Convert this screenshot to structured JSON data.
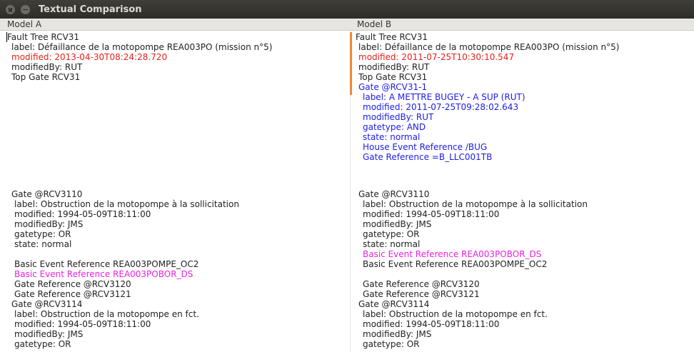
{
  "window": {
    "title": "Textual Comparison"
  },
  "colors": {
    "modified_removed": "#e8221a",
    "added": "#1c1ce6",
    "moved": "#f020e6",
    "change_marker": "#f08a34"
  },
  "paneA": {
    "header": "Model A",
    "lines": [
      "Fault Tree RCV31",
      "label: Défaillance de la motopompe REA003PO (mission n°5)",
      "modified: 2013-04-30T08:24:28.720",
      "modifiedBy: RUT",
      "Top Gate RCV31",
      "Gate @RCV3110",
      "label: Obstruction de la motopompe à la sollicitation",
      "modified: 1994-05-09T18:11:00",
      "modifiedBy: JMS",
      "gatetype: OR",
      "state: normal",
      "Basic Event Reference REA003POMPE_OC2",
      "Basic Event Reference REA003POBOR_DS",
      "Gate Reference @RCV3120",
      "Gate Reference @RCV3121",
      "Gate @RCV3114",
      "label: Obstruction de la motopompe en fct.",
      "modified: 1994-05-09T18:11:00",
      "modifiedBy: JMS",
      "gatetype: OR"
    ]
  },
  "paneB": {
    "header": "Model B",
    "lines": [
      "Fault Tree RCV31",
      "label: Défaillance de la motopompe REA003PO (mission n°5)",
      "modified: 2011-07-25T10:30:10.547",
      "modifiedBy: RUT",
      "Top Gate RCV31",
      "Gate @RCV31-1",
      "label: A METTRE BUGEY - A SUP (RUT)",
      "modified: 2011-07-25T09:28:02.643",
      "modifiedBy: RUT",
      "gatetype: AND",
      "state: normal",
      "House Event Reference /BUG",
      "Gate Reference =B_LLC001TB",
      "Gate @RCV3110",
      "label: Obstruction de la motopompe à la sollicitation",
      "modified: 1994-05-09T18:11:00",
      "modifiedBy: JMS",
      "gatetype: OR",
      "state: normal",
      "Basic Event Reference REA003POBOR_DS",
      "Basic Event Reference REA003POMPE_OC2",
      "Gate Reference @RCV3120",
      "Gate Reference @RCV3121",
      "Gate @RCV3114",
      "label: Obstruction de la motopompe en fct.",
      "modified: 1994-05-09T18:11:00",
      "modifiedBy: JMS",
      "gatetype: OR"
    ]
  }
}
